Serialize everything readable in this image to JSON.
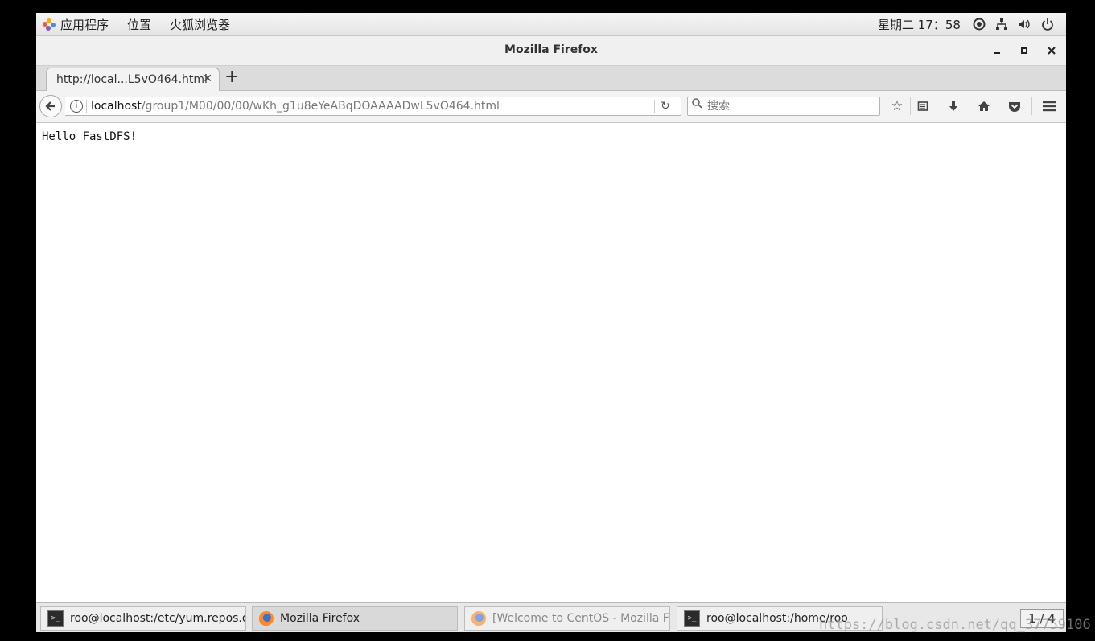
{
  "topbar": {
    "menus": [
      "应用程序",
      "位置",
      "火狐浏览器"
    ],
    "clock": "星期二 17：58",
    "icons": [
      "accessibility-icon",
      "network-icon",
      "volume-icon",
      "power-icon"
    ]
  },
  "window": {
    "title": "Mozilla Firefox",
    "buttons": [
      "minimize",
      "maximize",
      "close"
    ]
  },
  "tabs": [
    {
      "label": "http://local...L5vO464.html",
      "active": true
    }
  ],
  "navbar": {
    "url_host": "localhost",
    "url_path": "/group1/M00/00/00/wKh_g1u8eYeABqDOAAAADwL5vO464.html",
    "search_placeholder": "搜索",
    "toolbar_icons": [
      "bookmark-star-icon",
      "reading-list-icon",
      "download-icon",
      "home-icon",
      "pocket-icon",
      "hamburger-menu-icon"
    ]
  },
  "page": {
    "text": "Hello FastDFS!"
  },
  "taskbar": {
    "items": [
      {
        "label": "roo@localhost:/etc/yum.repos.d",
        "icon": "terminal-icon",
        "state": "normal"
      },
      {
        "label": "Mozilla Firefox",
        "icon": "firefox-icon",
        "state": "active"
      },
      {
        "label": "[Welcome to CentOS - Mozilla Fire…",
        "icon": "firefox-icon",
        "state": "minimized"
      },
      {
        "label": "roo@localhost:/home/roo",
        "icon": "terminal-icon",
        "state": "normal"
      }
    ],
    "pager": "1 / 4"
  },
  "watermark": "https://blog.csdn.net/qq_37759106"
}
